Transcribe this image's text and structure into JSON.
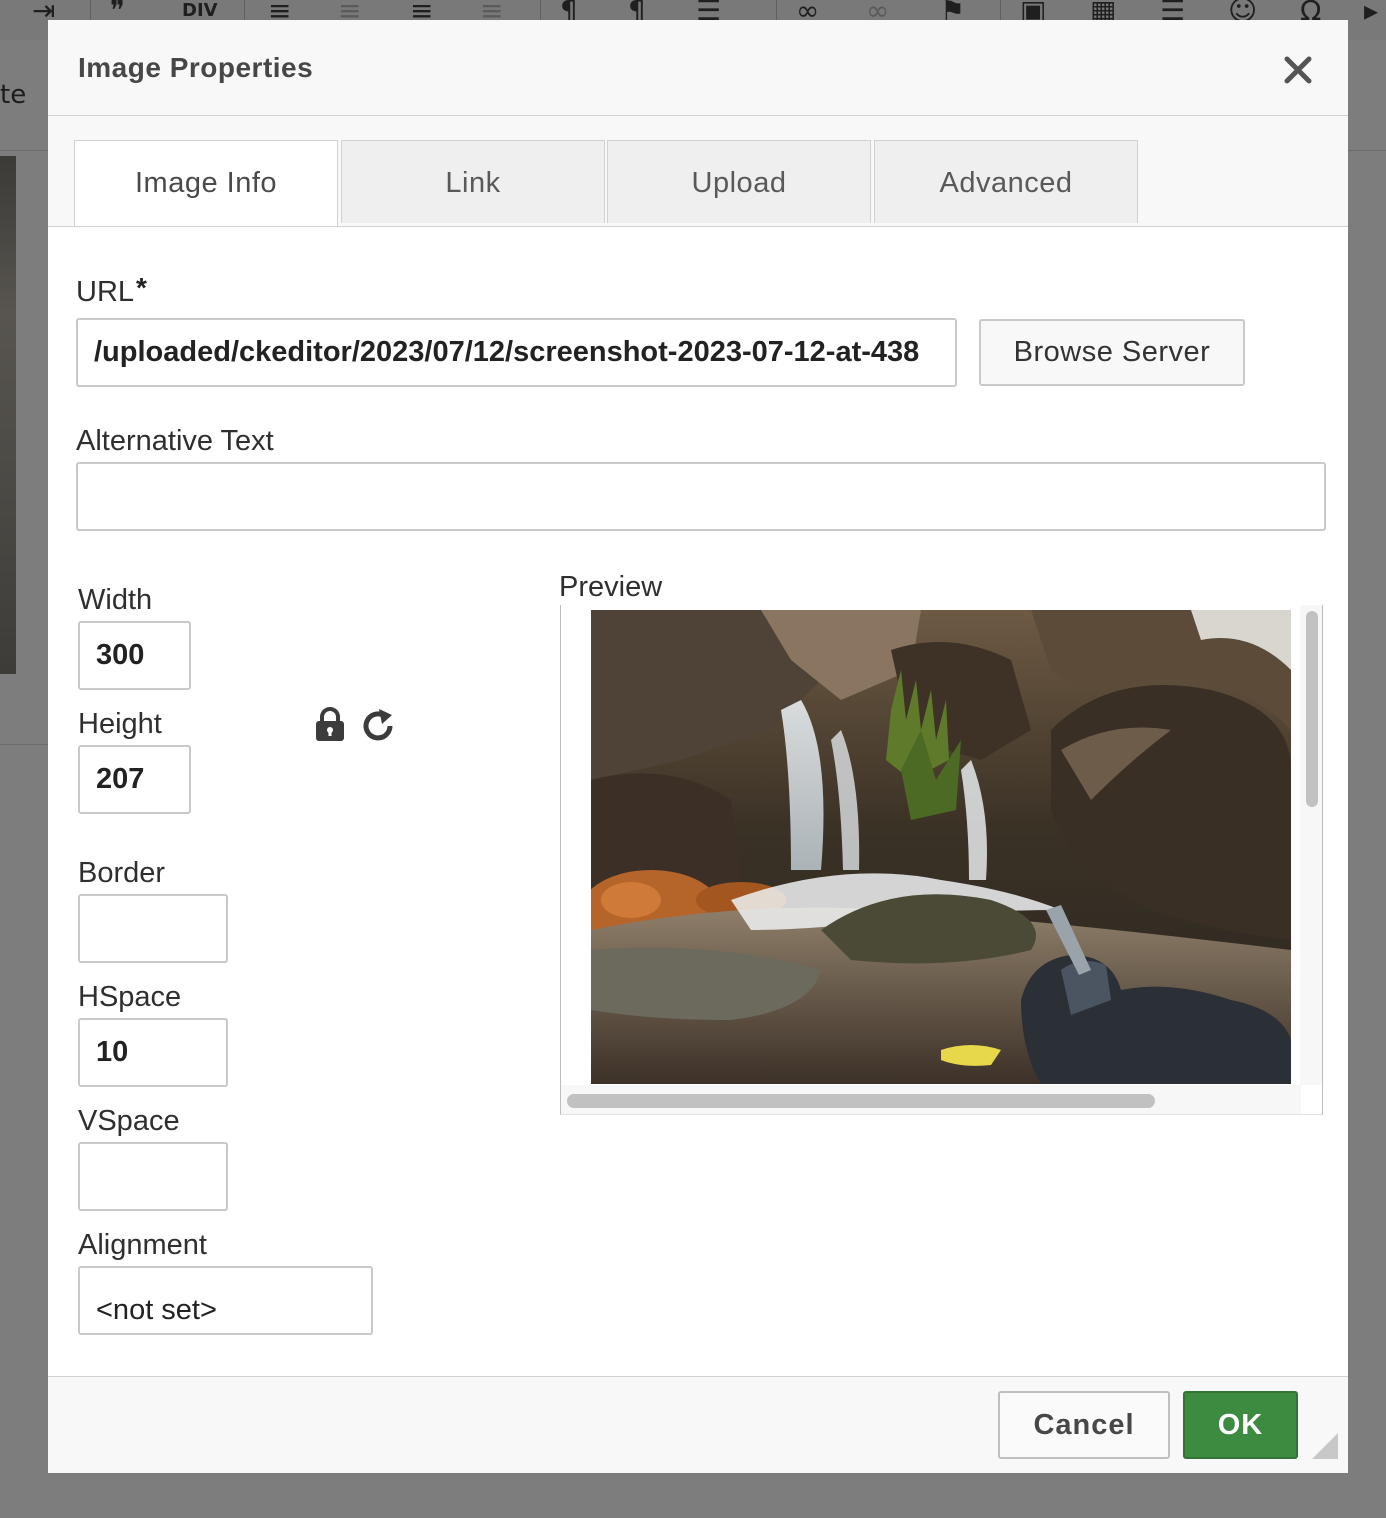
{
  "background": {
    "partial_word": "te"
  },
  "dialog": {
    "title": "Image Properties",
    "tabs": [
      {
        "label": "Image Info",
        "active": true
      },
      {
        "label": "Link",
        "active": false
      },
      {
        "label": "Upload",
        "active": false
      },
      {
        "label": "Advanced",
        "active": false
      }
    ],
    "url": {
      "label": "URL",
      "required_marker": "*",
      "value": "/uploaded/ckeditor/2023/07/12/screenshot-2023-07-12-at-438"
    },
    "browse_server_label": "Browse Server",
    "alt_text": {
      "label": "Alternative Text",
      "value": ""
    },
    "width": {
      "label": "Width",
      "value": "300"
    },
    "height": {
      "label": "Height",
      "value": "207"
    },
    "lock_ratio_icon": "lock-icon",
    "reset_size_icon": "refresh-icon",
    "border": {
      "label": "Border",
      "value": ""
    },
    "hspace": {
      "label": "HSpace",
      "value": "10"
    },
    "vspace": {
      "label": "VSpace",
      "value": ""
    },
    "alignment": {
      "label": "Alignment",
      "value": "<not set>"
    },
    "preview_label": "Preview",
    "footer": {
      "cancel_label": "Cancel",
      "ok_label": "OK"
    },
    "colors": {
      "ok_button": "#3d8b40",
      "header_bg": "#f8f8f8",
      "overlay": "#7d7d7d"
    }
  }
}
